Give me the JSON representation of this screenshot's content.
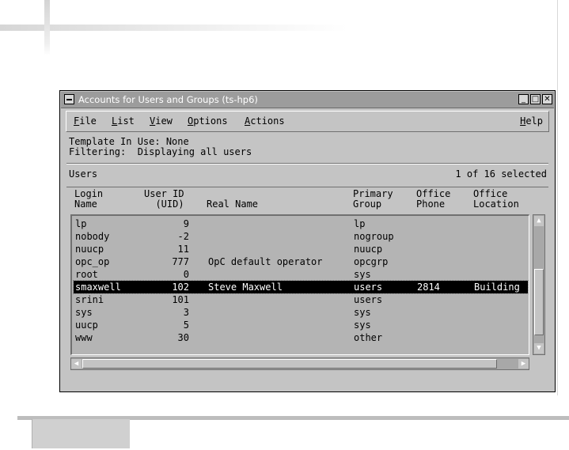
{
  "window": {
    "title": "Accounts for Users and Groups (ts-hp6)",
    "controls": {
      "minimize": "_",
      "maximize": "□",
      "close": "✕"
    }
  },
  "menu": [
    {
      "label": "File",
      "mnemonic": "F",
      "rest": "ile"
    },
    {
      "label": "List",
      "mnemonic": "L",
      "rest": "ist"
    },
    {
      "label": "View",
      "mnemonic": "V",
      "rest": "iew"
    },
    {
      "label": "Options",
      "mnemonic": "O",
      "rest": "ptions"
    },
    {
      "label": "Actions",
      "mnemonic": "A",
      "rest": "ctions"
    }
  ],
  "help": {
    "label": "Help",
    "mnemonic": "H",
    "rest": "elp"
  },
  "info": {
    "template": "Template In Use: None",
    "filtering": "Filtering:  Displaying all users"
  },
  "list": {
    "title": "Users",
    "selection_status": "1 of 16 selected",
    "headers": {
      "login": "Login\nName",
      "uid": "User ID\n  (UID)",
      "real": "Real Name",
      "group": "Primary\nGroup",
      "phone": "Office\nPhone",
      "location": "Office\nLocation"
    },
    "rows": [
      {
        "login": "lp",
        "uid": "9",
        "real": "",
        "group": "lp",
        "phone": "",
        "location": ""
      },
      {
        "login": "nobody",
        "uid": "-2",
        "real": "",
        "group": "nogroup",
        "phone": "",
        "location": ""
      },
      {
        "login": "nuucp",
        "uid": "11",
        "real": "",
        "group": "nuucp",
        "phone": "",
        "location": ""
      },
      {
        "login": "opc_op",
        "uid": "777",
        "real": "OpC default operator",
        "group": "opcgrp",
        "phone": "",
        "location": ""
      },
      {
        "login": "root",
        "uid": "0",
        "real": "",
        "group": "sys",
        "phone": "",
        "location": ""
      },
      {
        "login": "smaxwell",
        "uid": "102",
        "real": "Steve Maxwell",
        "group": "users",
        "phone": "2814",
        "location": "Building",
        "selected": true
      },
      {
        "login": "srini",
        "uid": "101",
        "real": "",
        "group": "users",
        "phone": "",
        "location": ""
      },
      {
        "login": "sys",
        "uid": "3",
        "real": "",
        "group": "sys",
        "phone": "",
        "location": ""
      },
      {
        "login": "uucp",
        "uid": "5",
        "real": "",
        "group": "sys",
        "phone": "",
        "location": ""
      },
      {
        "login": "www",
        "uid": "30",
        "real": "",
        "group": "other",
        "phone": "",
        "location": ""
      }
    ]
  },
  "scroll": {
    "up": "▲",
    "down": "▼",
    "left": "◀",
    "right": "▶"
  },
  "colors": {
    "window_bg": "#c4c4c4",
    "titlebar": "#9c9c9c",
    "list_bg": "#b4b4b4",
    "selected_bg": "#000000"
  }
}
